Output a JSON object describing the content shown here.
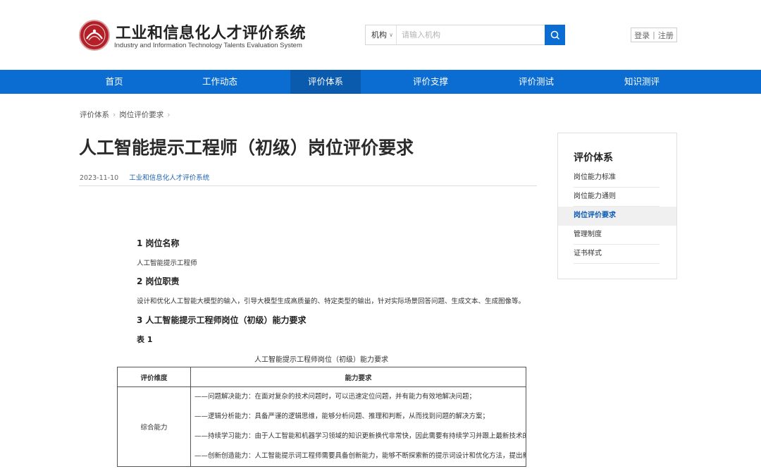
{
  "header": {
    "title": "工业和信息化人才评价系统",
    "subtitle": "Industry and Information Technology Talents Evaluation System",
    "logo_icon": "emblem-icon",
    "search": {
      "scope_label": "机构",
      "placeholder": "请输入机构"
    },
    "auth": {
      "login": "登录",
      "separator": "|",
      "register": "注册"
    }
  },
  "nav": {
    "items": [
      "首页",
      "工作动态",
      "评价体系",
      "评价支撑",
      "评价测试",
      "知识测评"
    ],
    "active_index": 2
  },
  "breadcrumb": [
    "评价体系",
    "岗位评价要求"
  ],
  "article": {
    "title": "人工智能提示工程师（初级）岗位评价要求",
    "date": "2023-11-10",
    "source": "工业和信息化人才评价系统",
    "sections": {
      "s1_heading": "1  岗位名称",
      "s1_body": "人工智能提示工程师",
      "s2_heading": "2  岗位职责",
      "s2_body": "设计和优化人工智能大模型的输入，引导大模型生成高质量的、特定类型的输出，针对实际场景回答问题、生成文本、生成图像等。",
      "s3_heading": "3  人工智能提示工程师岗位（初级）能力要求",
      "table_label": "表 1",
      "table_caption": "人工智能提示工程师岗位（初级）能力要求"
    },
    "table": {
      "headers": [
        "评价维度",
        "能力要求"
      ],
      "row_dimension": "综合能力",
      "requirements": [
        "——问题解决能力：在面对复杂的技术问题时，可以迅速定位问题，并有能力有效地解决问题；",
        "——逻辑分析能力：具备严谨的逻辑思维，能够分析问题、推理和判断，从而找到问题的解决方案；",
        "——持续学习能力：由于人工智能和机器学习领域的知识更新换代非常快，因此需要有持续学习并跟上最新技术的能力；",
        "——创新创造能力：人工智能提示词工程师需要具备创新能力，能够不断探索新的提示词设计和优化方法，提出新的思路"
      ]
    }
  },
  "sidebar": {
    "title": "评价体系",
    "items": [
      "岗位能力标准",
      "岗位能力通则",
      "岗位评价要求",
      "管理制度",
      "证书样式"
    ],
    "active_index": 2
  },
  "colors": {
    "primary": "#0b6dd1",
    "primary_dark": "#0a5aad",
    "logo_red": "#b32028",
    "link_blue": "#1f64b5"
  }
}
